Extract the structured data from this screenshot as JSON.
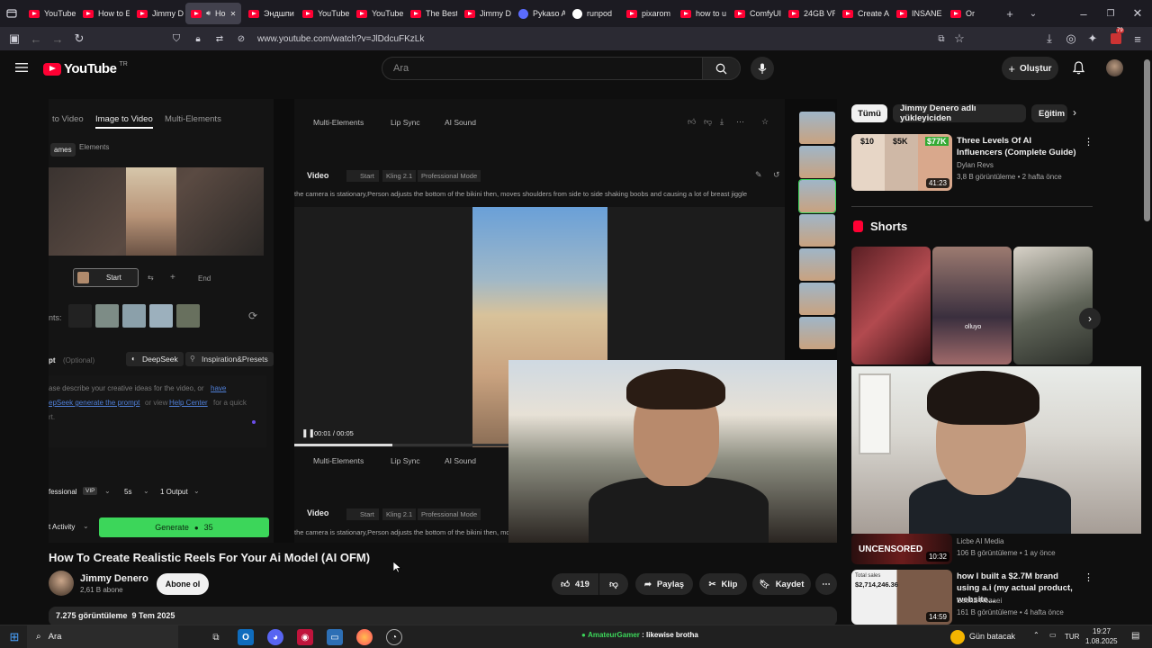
{
  "browser": {
    "tabs": [
      {
        "label": "YouTube",
        "icon": "youtube-icon"
      },
      {
        "label": "How to E",
        "icon": "youtube-icon"
      },
      {
        "label": "Jimmy D",
        "icon": "youtube-icon"
      },
      {
        "label": "Ho",
        "icon": "youtube-icon",
        "active": true
      },
      {
        "label": "Эндшпи",
        "icon": "youtube-icon"
      },
      {
        "label": "YouTube",
        "icon": "youtube-icon"
      },
      {
        "label": "YouTube",
        "icon": "youtube-icon"
      },
      {
        "label": "The Best",
        "icon": "youtube-icon"
      },
      {
        "label": "Jimmy D",
        "icon": "youtube-icon"
      },
      {
        "label": "Pykaso A",
        "icon": "pykaso-icon"
      },
      {
        "label": "runpod",
        "icon": "runpod-icon"
      },
      {
        "label": "pixarom",
        "icon": "youtube-icon"
      },
      {
        "label": "how to u",
        "icon": "youtube-icon"
      },
      {
        "label": "ComfyUI",
        "icon": "youtube-icon"
      },
      {
        "label": "24GB VR",
        "icon": "youtube-icon"
      },
      {
        "label": "Create A",
        "icon": "youtube-icon"
      },
      {
        "label": "INSANE",
        "icon": "youtube-icon"
      },
      {
        "label": "Or",
        "icon": "multi-icon"
      }
    ],
    "url": "www.youtube.com/watch?v=JlDdcuFKzLk",
    "badge": "79"
  },
  "youtube": {
    "logo_text": "YouTube",
    "logo_region": "TR",
    "search_placeholder": "Ara",
    "create_label": "Oluştur"
  },
  "player": {
    "tabs": [
      "to Video",
      "Image to Video",
      "Multi-Elements"
    ],
    "subtabs": [
      "ames",
      "Elements"
    ],
    "start_label": "Start",
    "end_label": "End",
    "elements_label": "nts:",
    "prompt_label": "pt",
    "prompt_optional": "(Optional)",
    "deepseek_label": "DeepSeek",
    "inspiration_label": "Inspiration&Presets",
    "prompt_line1": "ase describe your creative ideas for the video, or",
    "prompt_line1_link": "have",
    "prompt_line2_link": "epSeek generate the prompt",
    "prompt_line2b": "or view",
    "prompt_line2_help": "Help Center",
    "prompt_line2c": "for a quick",
    "prompt_line3": "rt.",
    "mode": "fessional",
    "vip": "VIP",
    "duration": "5s",
    "outputs": "1 Output",
    "activity": "t Activity",
    "generate_label": "Generate",
    "generate_cost": "35",
    "toolbar": [
      "Multi-Elements",
      "Lip Sync",
      "AI Sound"
    ],
    "video_label": "Video",
    "video_start": "Start",
    "model": "Kling 2.1",
    "pro_mode": "Professional Mode",
    "prompt_text": "the camera is stationary,Person adjusts the bottom of the bikini then, moves shoulders from side to side shaking boobs and causing a lot of breast jiggle",
    "prompt_text2": "the camera is stationary,Person adjusts the bottom of the bikini then, moves shoulders from side to side",
    "time": "00:01 / 00:05",
    "progress": 0.2
  },
  "video": {
    "title": "How To Create Realistic Reels For Your Ai Model (AI OFM)",
    "channel": "Jimmy Denero",
    "subscribers": "2,61 B abone",
    "subscribe_label": "Abone ol",
    "likes": "419",
    "share_label": "Paylaş",
    "clip_label": "Klip",
    "save_label": "Kaydet",
    "views": "7.275 görüntüleme",
    "date": "9 Tem 2025"
  },
  "sidebar": {
    "chips": [
      "Tümü",
      "Jimmy Denero adlı yükleyiciden",
      "Eğitim"
    ],
    "rec1": {
      "title": "Three Levels Of AI Influencers (Complete Guide)",
      "channel": "Dylan Revs",
      "meta": "3,8 B görüntüleme • 2 hafta önce",
      "duration": "41:23",
      "thumb_labels": [
        "$10",
        "$5K",
        "$77K"
      ]
    },
    "shorts_title": "Shorts",
    "short_label": "olluyo",
    "rec2": {
      "channel": "Licbe AI Media",
      "meta": "106 B görüntüleme • 1 ay önce",
      "duration": "10:32",
      "thumb_text": "UNCENSORED"
    },
    "rec3": {
      "title": "how I built a $2.7M brand using a.i (my actual product, website...",
      "channel": "Seena Rezaei",
      "meta": "161 B görüntüleme • 4 hafta önce",
      "duration": "14:59",
      "thumb_label": "Total sales",
      "thumb_value": "$2,714,246.36"
    }
  },
  "taskbar": {
    "search": "Ara",
    "stream_user": "AmateurGamer",
    "stream_msg": ": likewise brotha",
    "weather": "Gün batacak",
    "lang": "TUR",
    "time": "19:27",
    "date": "1.08.2025"
  }
}
